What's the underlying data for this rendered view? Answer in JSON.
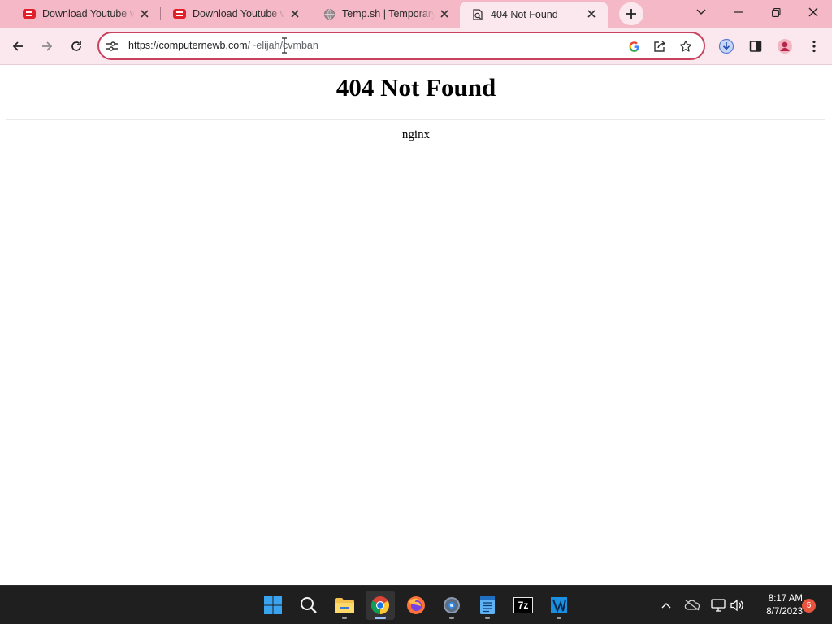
{
  "browser": {
    "tabs": [
      {
        "title": "Download Youtube videos",
        "favicon": "youtube-download-icon",
        "active": false
      },
      {
        "title": "Download Youtube videos",
        "favicon": "youtube-download-icon",
        "active": false
      },
      {
        "title": "Temp.sh | Temporary file hosting",
        "favicon": "globe-icon",
        "active": false
      },
      {
        "title": "404 Not Found",
        "favicon": "page-icon",
        "active": true
      }
    ],
    "address_bar": {
      "host": "https://computernewb.com",
      "path": "/~elijah/cvmban"
    }
  },
  "page": {
    "heading": "404 Not Found",
    "server": "nginx"
  },
  "taskbar": {
    "pinned_apps": [
      "start-icon",
      "search-icon",
      "file-explorer-icon",
      "chrome-icon",
      "firefox-icon",
      "settings-icon",
      "notepad-icon",
      "7zip-icon",
      "vs-icon"
    ],
    "seven_zip_label": "7z",
    "clock": {
      "time": "8:17 AM",
      "date": "8/7/2023"
    },
    "notification_count": "5"
  },
  "colors": {
    "tabstrip": "#f5b8c6",
    "toolbar": "#fbe8ee",
    "omnibox_border": "#c8425e",
    "taskbar": "#1f1f1f"
  }
}
